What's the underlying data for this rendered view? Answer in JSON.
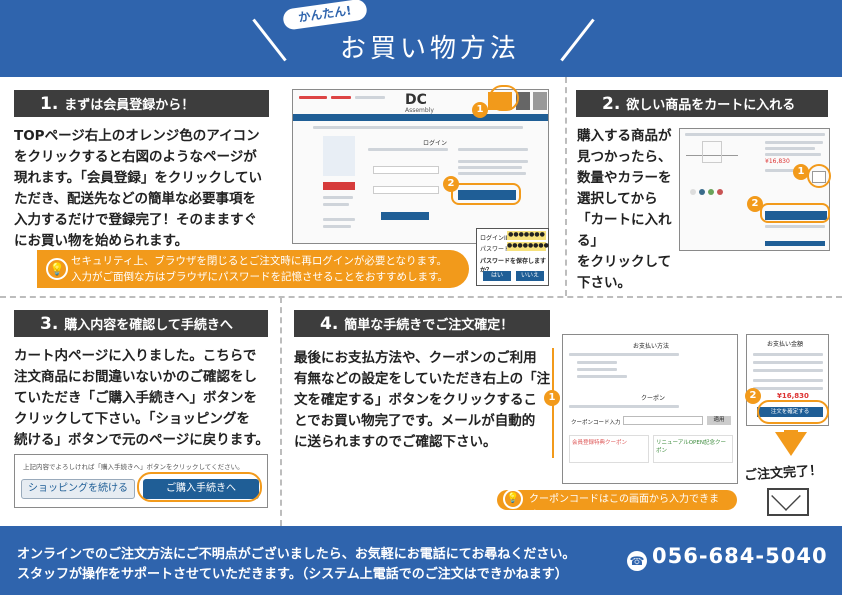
{
  "header": {
    "kicker": "かんたん!",
    "title": "お買い物方法"
  },
  "steps": [
    {
      "num": "1.",
      "title": "まずは会員登録から！",
      "body": [
        "TOPページ右上のオレンジ色のアイコン",
        "をクリックすると右図のようなページが",
        "現れます。「会員登録」をクリックしてい",
        "ただき、配送先などの簡単な必要事項を",
        "入力するだけで登録完了！そのまますぐ",
        "にお買い物を始められます。"
      ],
      "tip": [
        "セキュリティ上、ブラウザを閉じるとご注文時に再ログインが必要となります。",
        "入力がご面倒な方はブラウザにパスワードを記憶させることをおすすめします。"
      ]
    },
    {
      "num": "2.",
      "title": "欲しい商品をカートに入れる",
      "body": [
        "購入する商品が",
        "見つかったら、",
        "数量やカラーを",
        "選択してから",
        "「カートに入れる」",
        "をクリックして",
        "下さい。"
      ]
    },
    {
      "num": "3.",
      "title": "購入内容を確認して手続きへ",
      "body": [
        "カート内ページに入りました。こちらで",
        "注文商品にお間違いないかのご確認をし",
        "ていただき「ご購入手続きへ」ボタンを",
        "クリックして下さい。「ショッピングを",
        "続ける」ボタンで元のページに戻ります。"
      ],
      "mock_caption": "上記内容でよろしければ「購入手続きへ」ボタンをクリックしてください。",
      "btn_continue": "ショッピングを続ける",
      "btn_checkout": "ご購入手続きへ"
    },
    {
      "num": "4.",
      "title": "簡単な手続きでご注文確定！",
      "body": [
        "最後にお支払方法や、クーポンのご利用",
        "有無などの設定をしていただき右上の「注",
        "文を確定する」ボタンをクリックするこ",
        "とでお買い物完了です。メールが自動的",
        "に送られますのでご確認下さい。"
      ],
      "tip": "クーポンコードはこの画面から入力できます。",
      "done": "ご注文完了！"
    }
  ],
  "mock1": {
    "brand": "DC",
    "brand_sub": "Assembly",
    "login_title": "ログイン",
    "login_id": "ログインID",
    "password": "パスワード",
    "remember": "パスワードを保存しますか？",
    "yes": "はい",
    "no": "いいえ",
    "id_mask": "●●●●●●●",
    "pw_mask": "●●●●●●●●"
  },
  "mock2": {
    "price": "¥16,830"
  },
  "mock4": {
    "payment_title": "お支払い方法",
    "coupon_title": "クーポン",
    "coupon_code": "クーポンコード入力",
    "coupon_apply": "適用",
    "member_coupon": "会員登録特典クーポン",
    "renewal": "リニューアルOPEN記念クーポン",
    "summary_title": "お支払い金額",
    "total": "¥16,830",
    "confirm": "注文を確定する"
  },
  "footer": {
    "line1": "オンラインでのご注文方法にご不明点がございましたら、お気軽にお電話にてお尋ねください。",
    "line2": "スタッフが操作をサポートさせていただきます。（システム上電話でのご注文はできかねます）",
    "phone": "056-684-5040"
  },
  "colors": {
    "brand_blue": "#2f64ad",
    "accent_orange": "#f29a1b",
    "dark_bar": "#3d3d3d",
    "button_blue": "#1f5e96"
  }
}
